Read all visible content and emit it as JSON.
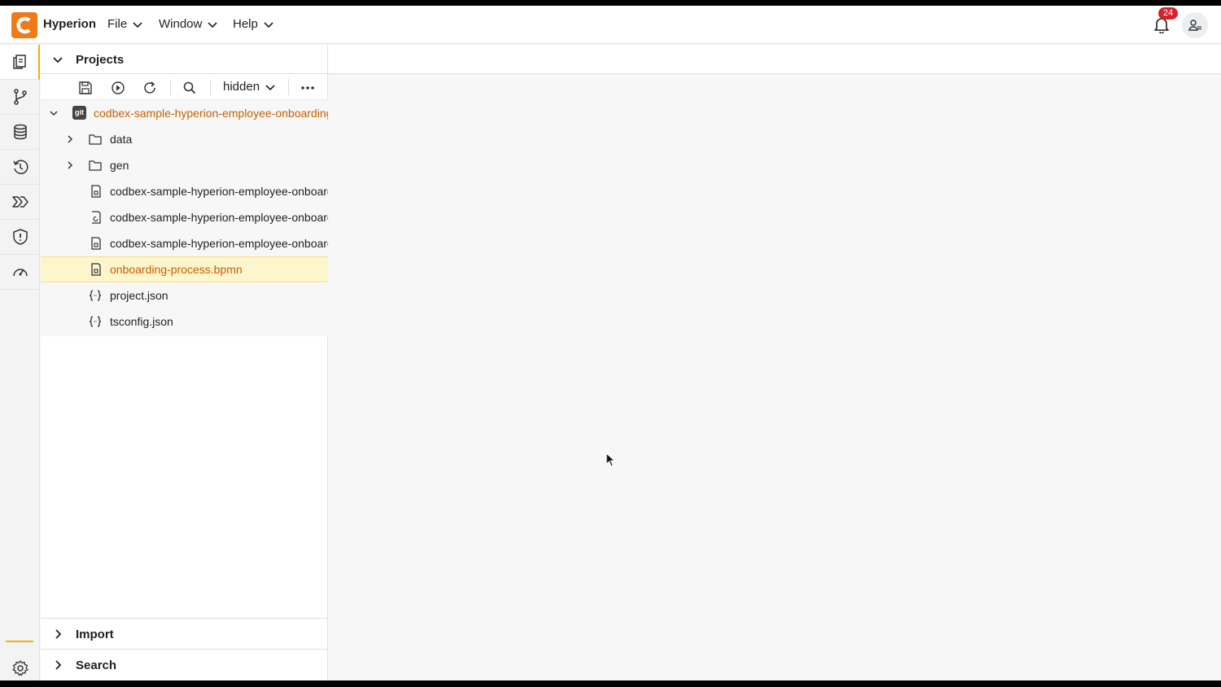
{
  "app": {
    "title": "Hyperion",
    "brand_color": "#ef7a1a"
  },
  "menu": [
    {
      "label": "File"
    },
    {
      "label": "Window"
    },
    {
      "label": "Help"
    }
  ],
  "notifications": {
    "count": "24"
  },
  "rail": [
    {
      "icon": "projects-icon",
      "active": true
    },
    {
      "icon": "git-branch-icon"
    },
    {
      "icon": "database-icon"
    },
    {
      "icon": "history-icon"
    },
    {
      "icon": "terminal-icon"
    },
    {
      "icon": "shield-icon"
    },
    {
      "icon": "speedometer-icon"
    },
    {
      "icon": "gear-icon"
    }
  ],
  "panel": {
    "title": "Projects",
    "filter": {
      "value": "hidden"
    },
    "tree": {
      "project": "codbex-sample-hyperion-employee-onboarding",
      "items": [
        {
          "label": "data",
          "type": "folder"
        },
        {
          "label": "gen",
          "type": "folder"
        },
        {
          "label": "codbex-sample-hyperion-employee-onboarding.edm",
          "type": "file"
        },
        {
          "label": "codbex-sample-hyperion-employee-onboarding.model",
          "type": "file-model"
        },
        {
          "label": "codbex-sample-hyperion-employee-onboarding.schema",
          "type": "file"
        },
        {
          "label": "onboarding-process.bpmn",
          "type": "file",
          "selected": true
        },
        {
          "label": "project.json",
          "type": "json"
        },
        {
          "label": "tsconfig.json",
          "type": "json"
        }
      ]
    },
    "sections": [
      {
        "label": "Import"
      },
      {
        "label": "Search"
      }
    ]
  },
  "colors": {
    "accent": "#f0b400",
    "selected_bg": "#fdf5cc",
    "selected_text": "#c85f00",
    "badge": "#d6202b"
  }
}
